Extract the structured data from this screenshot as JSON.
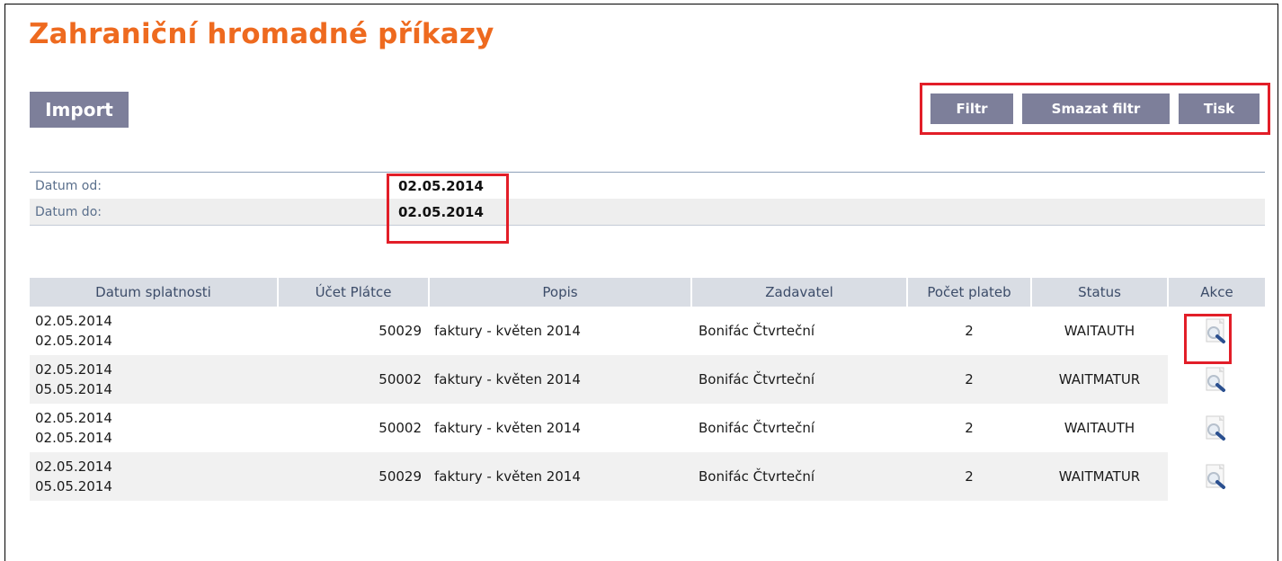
{
  "page": {
    "title": "Zahraniční hromadné příkazy",
    "import_label": "Import"
  },
  "toolbar": {
    "filter_label": "Filtr",
    "clear_filter_label": "Smazat filtr",
    "print_label": "Tisk"
  },
  "filter": {
    "date_from_label": "Datum od:",
    "date_from_value": "02.05.2014",
    "date_to_label": "Datum do:",
    "date_to_value": "02.05.2014"
  },
  "table": {
    "headers": [
      "Datum splatnosti",
      "Účet Plátce",
      "Popis",
      "Zadavatel",
      "Počet plateb",
      "Status",
      "Akce"
    ],
    "rows": [
      {
        "date1": "02.05.2014",
        "date2": "02.05.2014",
        "account": "50029",
        "description": "faktury - květen 2014",
        "submitter": "Bonifác Čtvrteční",
        "count": "2",
        "status": "WAITAUTH",
        "action_icon": "magnifier-icon"
      },
      {
        "date1": "02.05.2014",
        "date2": "05.05.2014",
        "account": "50002",
        "description": "faktury - květen 2014",
        "submitter": "Bonifác Čtvrteční",
        "count": "2",
        "status": "WAITMATUR",
        "action_icon": "magnifier-icon"
      },
      {
        "date1": "02.05.2014",
        "date2": "02.05.2014",
        "account": "50002",
        "description": "faktury - květen 2014",
        "submitter": "Bonifác Čtvrteční",
        "count": "2",
        "status": "WAITAUTH",
        "action_icon": "magnifier-icon"
      },
      {
        "date1": "02.05.2014",
        "date2": "05.05.2014",
        "account": "50029",
        "description": "faktury - květen 2014",
        "submitter": "Bonifác Čtvrteční",
        "count": "2",
        "status": "WAITMATUR",
        "action_icon": "magnifier-icon"
      }
    ]
  },
  "colors": {
    "title": "#ee6a1f",
    "button": "#7d7f9a",
    "highlight": "#e21e28",
    "header_bg": "#d9dde4"
  }
}
